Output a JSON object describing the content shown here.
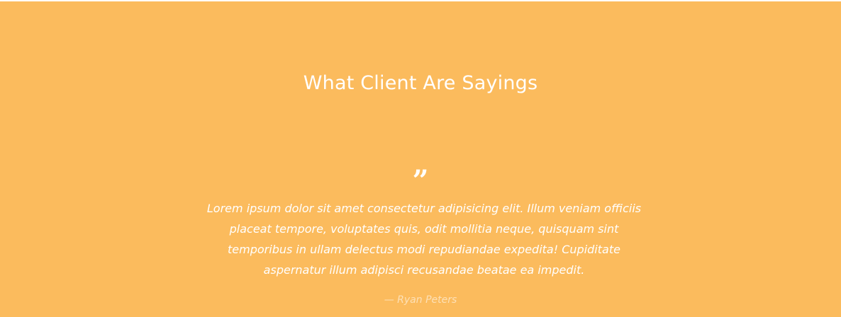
{
  "section": {
    "title": "What Client Are Sayings",
    "quote_icon": "”",
    "testimonial": {
      "text": "Lorem ipsum dolor sit amet consectetur adipisicing elit. Illum veniam officiis placeat tempore, voluptates quis, odit mollitia neque, quisquam sint temporibus in ullam delectus modi repudiandae expedita! Cupiditate aspernatur illum adipisci recusandae beatae ea impedit.",
      "author": "— Ryan Peters"
    }
  },
  "colors": {
    "background": "#fbbb5d",
    "text": "#ffffff"
  }
}
